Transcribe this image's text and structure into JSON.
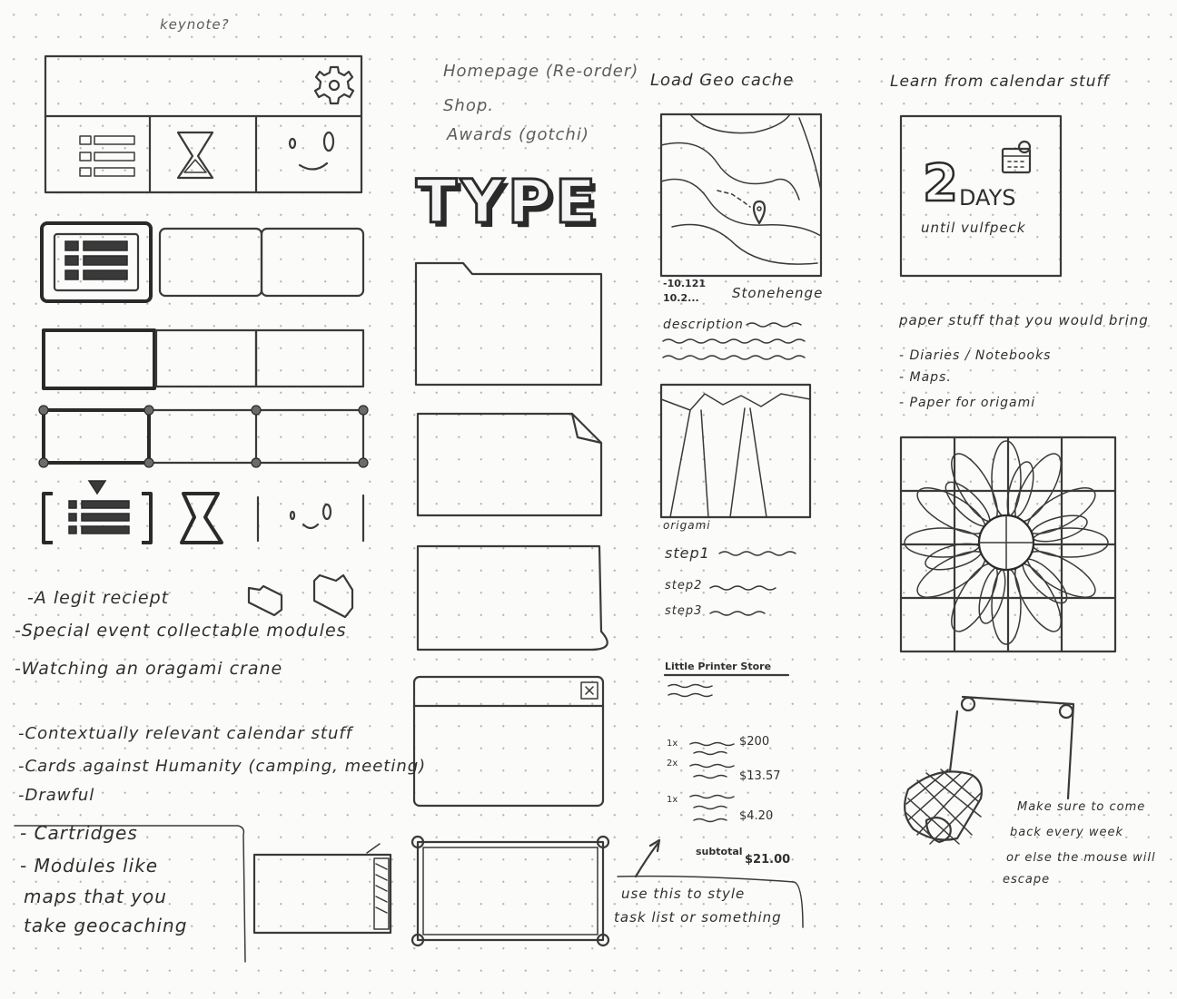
{
  "col1": {
    "top_note": "keynote?",
    "notes": [
      "-A legit reciept",
      "-Special event collectable modules",
      "-Watching an oragami crane"
    ],
    "notes2": [
      "-Contextually relevant calendar stuff",
      "-Cards against Humanity (camping, meeting)",
      "-Drawful"
    ],
    "boxed_notes": [
      "- Cartridges",
      "- Modules like",
      "maps that you",
      "take geocaching"
    ]
  },
  "col2": {
    "menu_items": [
      "Homepage (Re-order)",
      "Shop.",
      "Awards (gotchi)"
    ],
    "type_title": "TYPE"
  },
  "col3": {
    "title": "Load Geo cache",
    "map_dates": [
      "-10.121",
      "10.2..."
    ],
    "map_place": "Stonehenge",
    "map_desc_label": "description",
    "origami_label": "origami",
    "steps": [
      "step1",
      "step2",
      "step3"
    ],
    "store_title": "Little Printer Store",
    "receipt": [
      {
        "qty": "1x",
        "price": "$200"
      },
      {
        "qty": "2x",
        "price": "$13.57"
      },
      {
        "qty": "1x",
        "price": "$4.20"
      }
    ],
    "subtotal_label": "subtotal",
    "subtotal_value": "$21.00",
    "task_note_1": "use this to style",
    "task_note_2": "task list or something"
  },
  "col4": {
    "title": "Learn from calendar stuff",
    "countdown_number": "2",
    "countdown_unit": "DAYS",
    "countdown_until": "until vulfpeck",
    "paper_title": "paper stuff that you would bring",
    "paper_items": [
      "- Diaries / Notebooks",
      "- Maps.",
      "- Paper for origami"
    ],
    "mouse_note": [
      "Make sure to come",
      "back every week",
      "or else the mouse will",
      "escape"
    ]
  },
  "icons": {
    "settings": "gear-icon",
    "list": "list-icon",
    "hourglass": "hourglass-icon",
    "face": "face-icon",
    "folder": "folder-icon",
    "calendar": "calendar-icon",
    "map_pin": "map-pin-icon",
    "arrow": "arrow-icon"
  }
}
